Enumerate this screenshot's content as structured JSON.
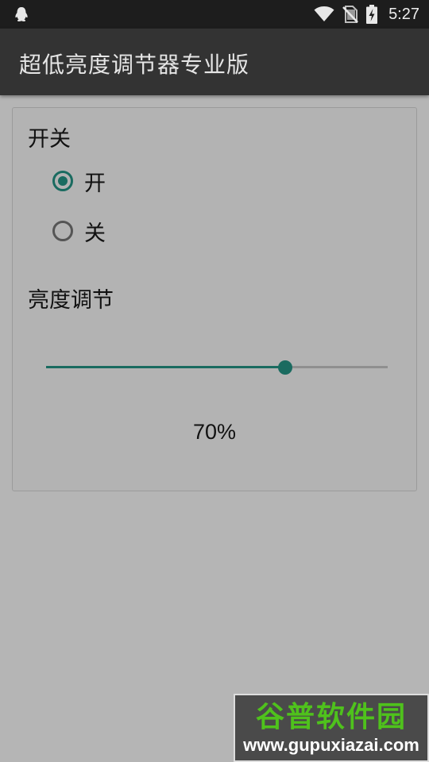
{
  "status_bar": {
    "time": "5:27",
    "icons": [
      "qq-penguin-icon",
      "wifi-icon",
      "no-sim-icon",
      "battery-charging-icon"
    ]
  },
  "app_bar": {
    "title": "超低亮度调节器专业版"
  },
  "switch_section": {
    "label": "开关",
    "options": [
      {
        "label": "开",
        "checked": true
      },
      {
        "label": "关",
        "checked": false
      }
    ]
  },
  "brightness_section": {
    "label": "亮度调节",
    "value_percent": 70,
    "value_text": "70%"
  },
  "colors": {
    "accent": "#1a6b60",
    "background": "#b5b5b5",
    "app_bar": "#333333",
    "status_bar": "#1d1d1d"
  },
  "watermark": {
    "name": "谷普软件园",
    "url": "www.gupuxiazai.com"
  }
}
